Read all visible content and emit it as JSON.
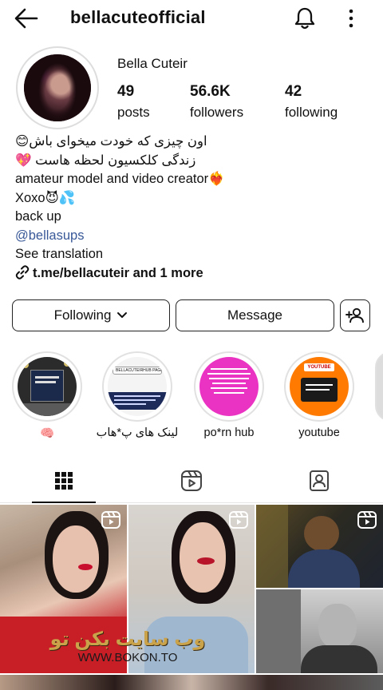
{
  "header": {
    "username": "bellacuteofficial"
  },
  "profile": {
    "display_name": "Bella Cuteir",
    "stats": [
      {
        "value": "49",
        "label": "posts"
      },
      {
        "value": "56.6K",
        "label": "followers"
      },
      {
        "value": "42",
        "label": "following"
      }
    ]
  },
  "bio": {
    "line1": "اون چیزی که خودت میخوای باش😊",
    "line2": "زندگی کلکسیون لحظه هاست 💖",
    "line3": "amateur model and video creator❤️‍🔥",
    "line4": "Xoxo😈💦",
    "line5": "back up",
    "mention": "@bellasups",
    "see_translation": "See translation",
    "link": "t.me/bellacuteir and 1 more"
  },
  "actions": {
    "following_label": "Following",
    "message_label": "Message"
  },
  "highlights": [
    {
      "label": "🧠"
    },
    {
      "label": "لینک های پ*هاب"
    },
    {
      "label": "po*rn hub"
    },
    {
      "label": "youtube"
    }
  ],
  "watermark": {
    "fa": "وب سایت بکن تو",
    "url": "WWW.BOKON.TO"
  },
  "highlight_text": {
    "h2_top": "BELLACUTEIRHUB PAGE",
    "h4_top": "YOUTUBE"
  },
  "icons": {
    "back": "arrow-left-icon",
    "bell": "bell-icon",
    "more": "more-vertical-icon",
    "add_user": "add-user-icon",
    "grid_tab": "grid-icon",
    "reels_tab": "reels-icon",
    "tagged_tab": "tagged-icon",
    "reel_badge": "reel-icon"
  },
  "colors": {
    "link": "#385898",
    "highlight_pink": "#ea33c2",
    "highlight_orange": "#ff7a00"
  }
}
